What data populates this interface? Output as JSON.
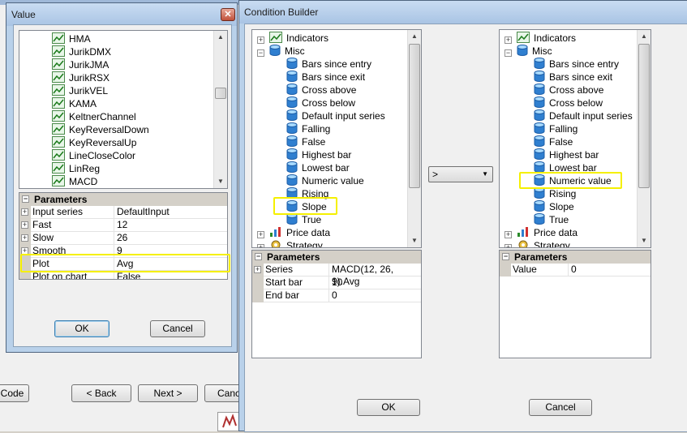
{
  "background": {
    "buttons": {
      "code": "Code",
      "back": "< Back",
      "next": "Next >",
      "cancel": "Canc"
    }
  },
  "value_dialog": {
    "title": "Value",
    "indicator_list": [
      "HMA",
      "JurikDMX",
      "JurikJMA",
      "JurikRSX",
      "JurikVEL",
      "KAMA",
      "KeltnerChannel",
      "KeyReversalDown",
      "KeyReversalUp",
      "LineCloseColor",
      "LinReg",
      "MACD"
    ],
    "parameters_header": "Parameters",
    "parameters": [
      {
        "name": "Input series",
        "value": "DefaultInput",
        "expandable": true
      },
      {
        "name": "Fast",
        "value": "12",
        "expandable": true
      },
      {
        "name": "Slow",
        "value": "26",
        "expandable": true
      },
      {
        "name": "Smooth",
        "value": "9",
        "expandable": true
      },
      {
        "name": "Plot",
        "value": "Avg",
        "expandable": false
      },
      {
        "name": "Plot on chart",
        "value": "False",
        "expandable": false
      }
    ],
    "ok_label": "OK",
    "cancel_label": "Cancel"
  },
  "condition_builder": {
    "title": "Condition Builder",
    "left_tree": {
      "categories": {
        "indicators": "Indicators",
        "misc": "Misc",
        "price_data": "Price data",
        "strategy": "Strategy"
      },
      "misc_items": [
        "Bars since entry",
        "Bars since exit",
        "Cross above",
        "Cross below",
        "Default input series",
        "Falling",
        "False",
        "Highest bar",
        "Lowest bar",
        "Numeric value",
        "Rising",
        "Slope",
        "True"
      ],
      "selected": "Slope"
    },
    "right_tree": {
      "categories": {
        "indicators": "Indicators",
        "misc": "Misc",
        "price_data": "Price data",
        "strategy": "Strategy"
      },
      "misc_items": [
        "Bars since entry",
        "Bars since exit",
        "Cross above",
        "Cross below",
        "Default input series",
        "Falling",
        "False",
        "Highest bar",
        "Lowest bar",
        "Numeric value",
        "Rising",
        "Slope",
        "True"
      ],
      "selected": "Numeric value"
    },
    "operator": {
      "selected": ">"
    },
    "left_params": {
      "header": "Parameters",
      "rows": [
        {
          "name": "Series",
          "value": "MACD(12, 26, 9).Avg",
          "expandable": true
        },
        {
          "name": "Start bar",
          "value": "10",
          "expandable": false
        },
        {
          "name": "End bar",
          "value": "0",
          "expandable": false
        }
      ]
    },
    "right_params": {
      "header": "Parameters",
      "rows": [
        {
          "name": "Value",
          "value": "0",
          "expandable": false
        }
      ]
    },
    "ok_label": "OK",
    "cancel_label": "Cancel"
  },
  "colors": {
    "highlight": "#f5f000",
    "window_frame": "#b9d1ea",
    "client_bg": "#f0f0f0",
    "grid_header": "#d4d0c8"
  }
}
